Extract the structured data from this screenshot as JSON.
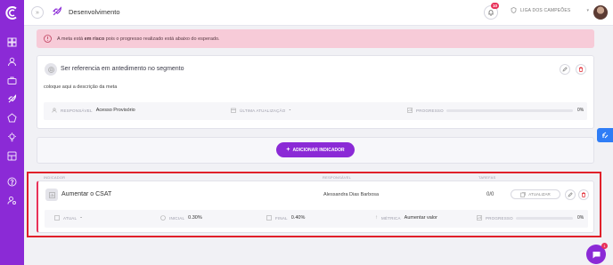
{
  "colors": {
    "brand": "#8b2ad6",
    "alert_bg": "#f7cbd8",
    "danger": "#e0202a",
    "accent_blue": "#2f7df6"
  },
  "sidebar": {
    "logo_icon": "brand-logo-icon",
    "items": [
      {
        "icon": "grid-icon"
      },
      {
        "icon": "user-icon"
      },
      {
        "icon": "briefcase-icon"
      },
      {
        "icon": "rocket-icon"
      },
      {
        "icon": "trophy-icon"
      },
      {
        "icon": "lightbulb-icon"
      },
      {
        "icon": "dashboard-icon"
      },
      {
        "icon": "help-icon"
      },
      {
        "icon": "user-settings-icon"
      }
    ]
  },
  "header": {
    "title": "Desenvolvimento",
    "notification_count": "10",
    "league_label": "LIGA DOS CAMPEÕES"
  },
  "alert": {
    "prefix": "A meta está",
    "bold": "em risco",
    "suffix": "pois o progresso realizado está abaixo do esperado."
  },
  "goal": {
    "title": "Ser referencia em antedimento no segmento",
    "description": "coloque aqui a descrição da meta",
    "responsavel_label": "RESPONSÁVEL",
    "responsavel_value": "Acesso Provisório",
    "ultima_label": "ÚLTIMA ATUALIZAÇÃO",
    "ultima_value": "-",
    "progresso_label": "PROGRESSO",
    "progresso_value": "0%",
    "progress": 0
  },
  "add_indicator": {
    "label": "ADICIONAR INDICADOR"
  },
  "indicators": {
    "columns": {
      "indicador": "INDICADOR",
      "responsavel": "RESPONSÁVEL",
      "tarefas": "TAREFAS"
    },
    "items": [
      {
        "name": "Aumentar o CSAT",
        "responsavel": "Alessandra Dias Barbosa",
        "tarefas": "0/0",
        "atualizar_label": "ATUALIZAR",
        "atual_label": "ATUAL",
        "atual_value": "-",
        "inicial_label": "INICIAL",
        "inicial_value": "0.30%",
        "final_label": "FINAL",
        "final_value": "0.40%",
        "metrica_label": "MÉTRICA",
        "metrica_value": "Aumentar valor",
        "progresso_label": "PROGRESSO",
        "progresso_value": "0%",
        "progress": 0
      }
    ]
  }
}
